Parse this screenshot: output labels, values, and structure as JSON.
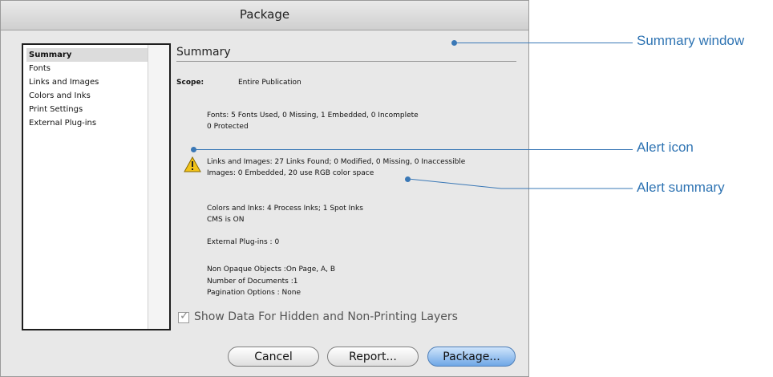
{
  "window": {
    "title": "Package"
  },
  "sidebar": {
    "items": [
      {
        "label": "Summary",
        "selected": true
      },
      {
        "label": "Fonts"
      },
      {
        "label": "Links and Images"
      },
      {
        "label": "Colors and Inks"
      },
      {
        "label": "Print Settings"
      },
      {
        "label": "External Plug-ins"
      }
    ]
  },
  "summary": {
    "heading": "Summary",
    "scope_label": "Scope:",
    "scope_value": "Entire Publication",
    "fonts_line1": "Fonts: 5 Fonts Used, 0 Missing, 1 Embedded, 0 Incomplete",
    "fonts_line2": "0 Protected",
    "links_line1": "Links and Images: 27 Links Found; 0 Modified, 0 Missing, 0 Inaccessible",
    "links_line2": "Images: 0 Embedded, 20 use RGB color space",
    "colors_line1": "Colors and Inks: 4 Process Inks; 1 Spot Inks",
    "colors_line2": "CMS is ON",
    "plugins_line": "External Plug-ins : 0",
    "non_opaque": "Non Opaque Objects :On Page, A, B",
    "num_docs": "Number of Documents :1",
    "pagination": "Pagination Options : None",
    "alert_icon": "warning-triangle-icon"
  },
  "checkbox": {
    "label": "Show Data For Hidden and Non-Printing Layers",
    "checked": true
  },
  "buttons": {
    "cancel": "Cancel",
    "report": "Report...",
    "package": "Package..."
  },
  "annotations": {
    "summary_window": "Summary window",
    "alert_icon": "Alert icon",
    "alert_summary": "Alert summary",
    "color": "#3a78b6"
  }
}
